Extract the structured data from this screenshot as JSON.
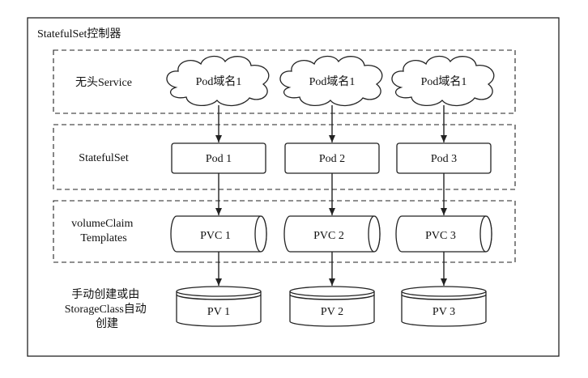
{
  "controller": {
    "title": "StatefulSet控制器"
  },
  "layers": [
    {
      "label_lines": [
        "无头Service"
      ]
    },
    {
      "label_lines": [
        "StatefulSet"
      ]
    },
    {
      "label_lines": [
        "volumeClaim",
        "Templates"
      ]
    }
  ],
  "provision_label_lines": [
    "手动创建或由",
    "StorageClass自动",
    "创建"
  ],
  "columns": [
    {
      "dns": "Pod域名1",
      "pod": "Pod 1",
      "pvc": "PVC 1",
      "pv": "PV 1"
    },
    {
      "dns": "Pod域名1",
      "pod": "Pod 2",
      "pvc": "PVC 2",
      "pv": "PV 2"
    },
    {
      "dns": "Pod域名1",
      "pod": "Pod 3",
      "pvc": "PVC 3",
      "pv": "PV 3"
    }
  ]
}
